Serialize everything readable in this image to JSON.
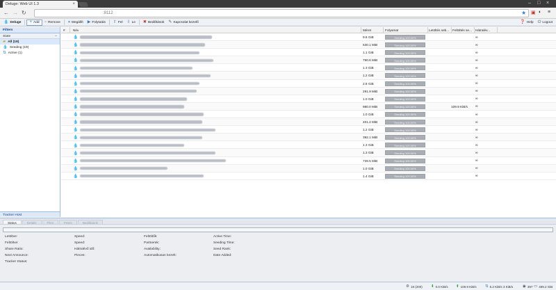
{
  "browser": {
    "tab_title": "Deluge: Web UI 1.3",
    "url_text": ":8112"
  },
  "toolbar": {
    "app": "Deluge",
    "add": "Add",
    "remove": "Remove",
    "pause": "Megállít",
    "resume": "Folytatás",
    "up": "Fel",
    "down": "Le",
    "preferences": "Beállítások",
    "connection": "Kapcsolat kezelő",
    "help": "Help",
    "logout": "Logout"
  },
  "sidebar": {
    "title": "Filters",
    "section": "State",
    "section_collapse": "−",
    "items": [
      {
        "label": "All (19)",
        "icon": "all-icon"
      },
      {
        "label": "Seeding (19)",
        "icon": "seeding-icon"
      },
      {
        "label": "Active (1)",
        "icon": "active-icon"
      }
    ],
    "tracker_host": "Tracker Host"
  },
  "grid": {
    "columns": {
      "num": "#",
      "name": "Név",
      "size": "Méret",
      "progress": "Folyamat",
      "download": "Letöltés seb...",
      "upload": "Feltöltés se...",
      "eta": "Hátralév..."
    },
    "rows": [
      {
        "num": "",
        "name": "The Fate of The Furious 2017 720p Hungarian.mkv",
        "size": "9.8 GiB",
        "progress": 100,
        "progress_label": "Seeding 100.00%",
        "dl": "",
        "ul": "",
        "eta": "∞",
        "w": 190
      },
      {
        "num": "",
        "name": "Game of Thrones S07E01 720p WEB x264 hun eng",
        "size": "630.1 MiB",
        "progress": 100,
        "progress_label": "Seeding 100.00%",
        "dl": "",
        "ul": "",
        "eta": "∞",
        "w": 180
      },
      {
        "num": "",
        "name": "Rick and Morty S03E01 720p WEB x264 hun",
        "size": "1.1 GiB",
        "progress": 100,
        "progress_label": "Seeding 100.00%",
        "dl": "",
        "ul": "",
        "eta": "∞",
        "w": 172
      },
      {
        "num": "",
        "name": "A Mi Kalandunk 2017 BluRay 1080p DTS HUN ENG",
        "size": "790.6 MiB",
        "progress": 100,
        "progress_label": "Seeding 100.00%",
        "dl": "",
        "ul": "",
        "eta": "∞",
        "w": 192
      },
      {
        "num": "",
        "name": "Baby Driver 2017 720p BluRay x264 hun",
        "size": "1.3 GiB",
        "progress": 100,
        "progress_label": "Seeding 100.00%",
        "dl": "",
        "ul": "",
        "eta": "∞",
        "w": 162
      },
      {
        "num": "",
        "name": "Going in Style 2017 720p BluRay x264 hun eng",
        "size": "1.2 GiB",
        "progress": 100,
        "progress_label": "Seeding 100.00%",
        "dl": "",
        "ul": "",
        "eta": "∞",
        "w": 188
      },
      {
        "num": "",
        "name": "Leszámolás 2016 1080p BluRay x264 hun",
        "size": "2.8 GiB",
        "progress": 100,
        "progress_label": "Seeding 100.00%",
        "dl": "",
        "ul": "",
        "eta": "∞",
        "w": 172
      },
      {
        "num": "",
        "name": "Game of Thrones S07E02 720p WEB x264 hun",
        "size": "291.9 MiB",
        "progress": 100,
        "progress_label": "Seeding 100.00%",
        "dl": "",
        "ul": "",
        "eta": "∞",
        "w": 168
      },
      {
        "num": "",
        "name": "The Boss Baby 2017 hun 720p WEB x264",
        "size": "1.0 GiB",
        "progress": 100,
        "progress_label": "Seeding 100.00%",
        "dl": "",
        "ul": "",
        "eta": "∞",
        "w": 154
      },
      {
        "num": "",
        "name": "Game of Thrones S07E03 720p WEB x264 hun eng",
        "size": "980.0 MiB",
        "progress": 100,
        "progress_label": "Seeding 100.00%",
        "dl": "",
        "ul": "109.9 KiB/s",
        "eta": "∞",
        "w": 150
      },
      {
        "num": "",
        "name": "Game of Thrones S07E04 720p WEB x264 hun",
        "size": "1.0 GiB",
        "progress": 100,
        "progress_label": "Seeding 100.00%",
        "dl": "",
        "ul": "",
        "eta": "∞",
        "w": 178
      },
      {
        "num": "",
        "name": "Agymenők S10E01 720p WEB x264 hun",
        "size": "401.2 MiB",
        "progress": 100,
        "progress_label": "Seeding 100.00%",
        "dl": "",
        "ul": "",
        "eta": "∞",
        "w": 176
      },
      {
        "num": "",
        "name": "The Unbreakable 2017 BluRay 720p hun eng",
        "size": "1.2 GiB",
        "progress": 100,
        "progress_label": "Seeding 100.00%",
        "dl": "",
        "ul": "",
        "eta": "∞",
        "w": 195
      },
      {
        "num": "",
        "name": "Agymenők S10E02 720p WEB x264 hun",
        "size": "392.1 MiB",
        "progress": 100,
        "progress_label": "Seeding 100.00%",
        "dl": "",
        "ul": "",
        "eta": "∞",
        "w": 176
      },
      {
        "num": "",
        "name": "Vasember 2008 720p BluRay x264 hun",
        "size": "1.3 GiB",
        "progress": 100,
        "progress_label": "Seeding 100.00%",
        "dl": "",
        "ul": "",
        "eta": "∞",
        "w": 150
      },
      {
        "num": "",
        "name": "King Arthur Legend of the Sword 2017 720p BluRay hun",
        "size": "1.3 GiB",
        "progress": 100,
        "progress_label": "Seeding 100.00%",
        "dl": "",
        "ul": "",
        "eta": "∞",
        "w": 195
      },
      {
        "num": "",
        "name": "Spider-Man Homecoming 2017 720p BluRay x264 hun eng",
        "size": "739.5 MiB",
        "progress": 100,
        "progress_label": "Seeding 100.00%",
        "dl": "",
        "ul": "",
        "eta": "∞",
        "w": 210
      },
      {
        "num": "",
        "name": "Life 2017 720p BluRay x264 hun",
        "size": "1.0 GiB",
        "progress": 100,
        "progress_label": "Seeding 100.00%",
        "dl": "",
        "ul": "",
        "eta": "∞",
        "w": 126
      },
      {
        "num": "",
        "name": "John Wick Chapter 2 2017 BluRay 1080p hun eng",
        "size": "1.4 GiB",
        "progress": 100,
        "progress_label": "Seeding 100.00%",
        "dl": "",
        "ul": "",
        "eta": "∞",
        "w": 178
      }
    ]
  },
  "details": {
    "tabs": [
      "Status",
      "Details",
      "Files",
      "Peers",
      "Beállítások"
    ],
    "progress": 0,
    "labels": [
      [
        "Letöltve:",
        "Feltöltve:",
        "Share Ratio:",
        "Next Announce:",
        "Tracker Status:"
      ],
      [
        "Speed:",
        "Speed:",
        "Hátralévő idő:",
        "Pieces:"
      ],
      [
        "Feltöltők:",
        "Partnerek:",
        "Availability:",
        "Automatikusan kezelt:"
      ],
      [
        "Active Time:",
        "Seeding Time:",
        "Seed Rank:",
        "Date Added:"
      ]
    ]
  },
  "statusbar": {
    "connections": "18 (200)",
    "down_speed": "0.0 KiB/s",
    "up_speed": "109.9 KiB/s",
    "protocol": "5.2 KiB/s 3 KiB/s",
    "dht": "397",
    "free_space": "499.2 GiB"
  },
  "colors": {
    "panel_border": "#99bbe8",
    "header_bg": "#dfe8f6",
    "torrent_icon": "#3a78c4"
  }
}
